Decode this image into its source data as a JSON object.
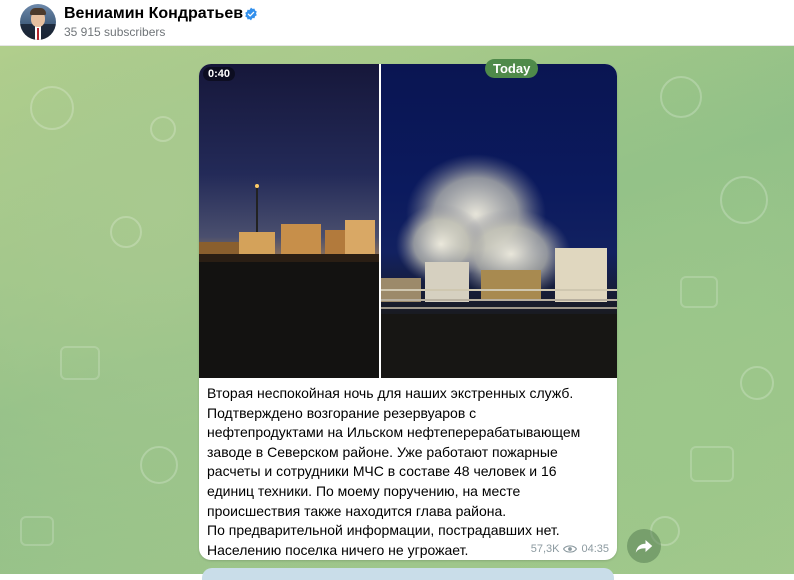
{
  "header": {
    "channel_name": "Вениамин Кондратьев",
    "subscribers": "35 915 subscribers"
  },
  "message": {
    "video_duration": "0:40",
    "date_label": "Today",
    "text": "Вторая неспокойная ночь для наших экстренных служб.\nПодтверждено возгорание резервуаров с\nнефтепродуктами на Ильском нефтеперерабатывающем\nзаводе в Северском районе. Уже работают пожарные\nрасчеты и сотрудники МЧС в составе 48 человек и 16\nединиц техники. По моему поручению, на месте\nпроисшествия также находится глава района.\nПо предварительной информации, пострадавших нет.\nНаселению поселка ничего не угрожает.",
    "views": "57,3K",
    "time": "04:35"
  },
  "icons": {
    "verified": "verified-badge-icon",
    "views": "eye-icon",
    "share": "share-arrow-icon"
  },
  "colors": {
    "accent": "#3390ec",
    "date_pill": "#4f8a4a",
    "meta_text": "#8c9aa0"
  }
}
